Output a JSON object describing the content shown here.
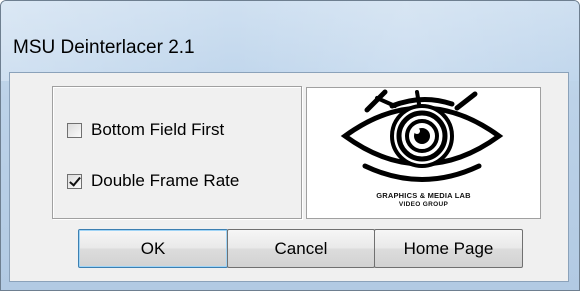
{
  "window": {
    "title": "MSU Deinterlacer 2.1"
  },
  "options": [
    {
      "label": "Bottom Field First",
      "checked": false
    },
    {
      "label": "Double Frame Rate",
      "checked": true
    }
  ],
  "logo": {
    "line1": "GRAPHICS & MEDIA LAB",
    "line2": "VIDEO GROUP",
    "icon": "eye-logo-icon"
  },
  "buttons": {
    "ok": "OK",
    "cancel": "Cancel",
    "home_page": "Home Page"
  }
}
